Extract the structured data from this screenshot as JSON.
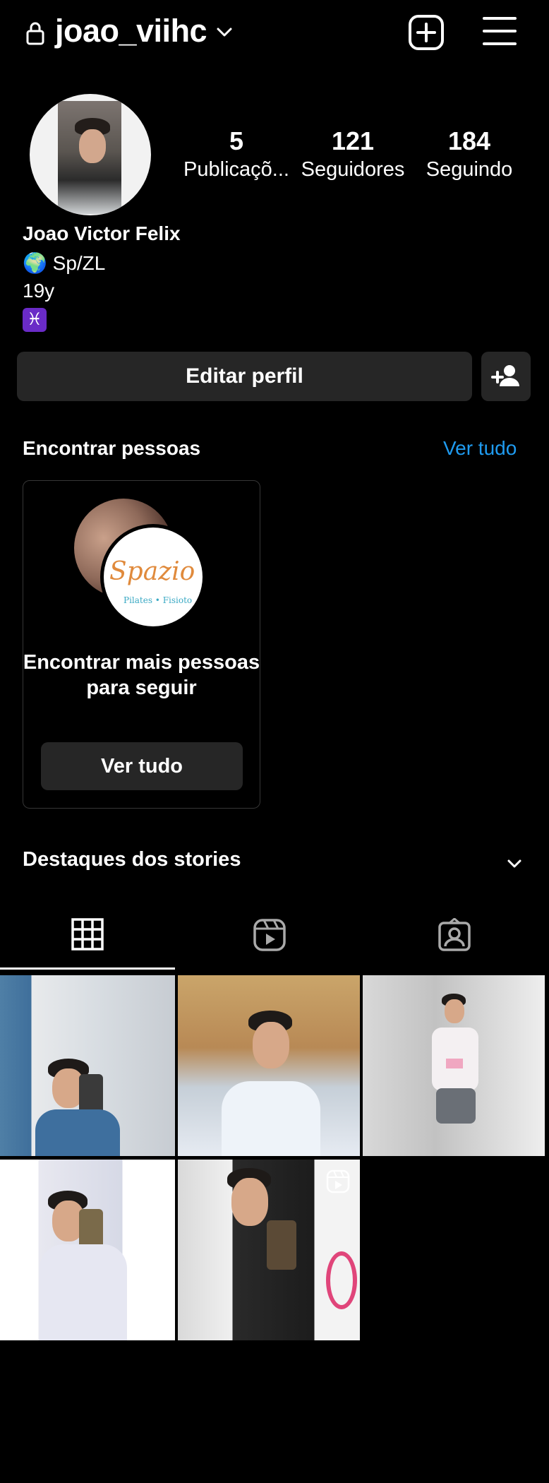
{
  "header": {
    "username": "joao_viihc"
  },
  "profile": {
    "stats": {
      "posts_count": "5",
      "posts_label": "Publicaçõ...",
      "followers_count": "121",
      "followers_label": "Seguidores",
      "following_count": "184",
      "following_label": "Seguindo"
    },
    "bio": {
      "name": "Joao Victor Felix",
      "location": "🌍 Sp/ZL",
      "age": "19y",
      "sign": "♓"
    },
    "edit_profile_label": "Editar perfil"
  },
  "discover": {
    "title": "Encontrar pessoas",
    "see_all_label": "Ver tudo",
    "card": {
      "logo_text": "Spazio Rea",
      "logo_sub": "Pilates • Fisioto",
      "text": "Encontrar mais pessoas para seguir",
      "button_label": "Ver tudo"
    }
  },
  "highlights": {
    "title": "Destaques dos stories"
  },
  "tabs": [
    {
      "icon": "grid-icon",
      "selected": true
    },
    {
      "icon": "reels-icon",
      "selected": false
    },
    {
      "icon": "tagged-icon",
      "selected": false
    }
  ],
  "colors": {
    "background": "#000000",
    "button_bg": "#262626",
    "link": "#1f9bf0",
    "text": "#ffffff"
  }
}
